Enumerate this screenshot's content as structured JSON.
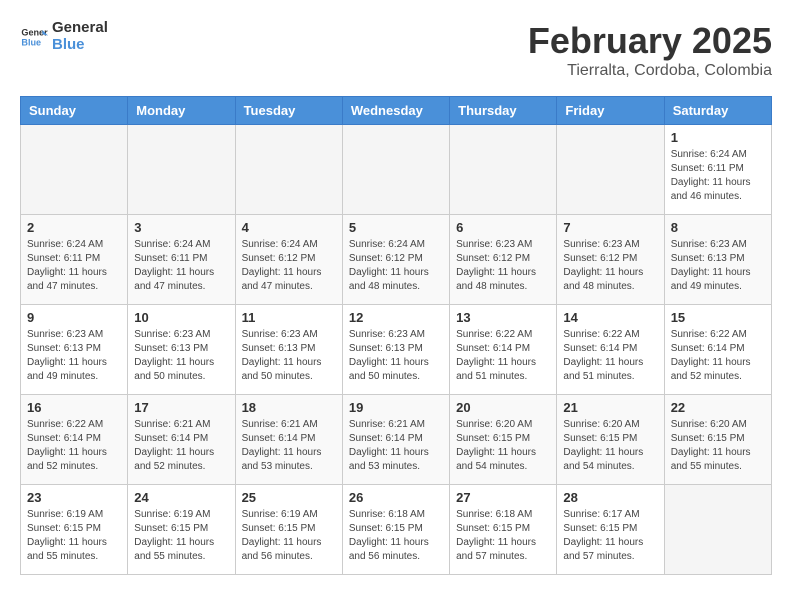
{
  "header": {
    "logo_general": "General",
    "logo_blue": "Blue",
    "month": "February 2025",
    "location": "Tierralta, Cordoba, Colombia"
  },
  "days_of_week": [
    "Sunday",
    "Monday",
    "Tuesday",
    "Wednesday",
    "Thursday",
    "Friday",
    "Saturday"
  ],
  "weeks": [
    [
      {
        "day": "",
        "info": ""
      },
      {
        "day": "",
        "info": ""
      },
      {
        "day": "",
        "info": ""
      },
      {
        "day": "",
        "info": ""
      },
      {
        "day": "",
        "info": ""
      },
      {
        "day": "",
        "info": ""
      },
      {
        "day": "1",
        "info": "Sunrise: 6:24 AM\nSunset: 6:11 PM\nDaylight: 11 hours and 46 minutes."
      }
    ],
    [
      {
        "day": "2",
        "info": "Sunrise: 6:24 AM\nSunset: 6:11 PM\nDaylight: 11 hours and 47 minutes."
      },
      {
        "day": "3",
        "info": "Sunrise: 6:24 AM\nSunset: 6:11 PM\nDaylight: 11 hours and 47 minutes."
      },
      {
        "day": "4",
        "info": "Sunrise: 6:24 AM\nSunset: 6:12 PM\nDaylight: 11 hours and 47 minutes."
      },
      {
        "day": "5",
        "info": "Sunrise: 6:24 AM\nSunset: 6:12 PM\nDaylight: 11 hours and 48 minutes."
      },
      {
        "day": "6",
        "info": "Sunrise: 6:23 AM\nSunset: 6:12 PM\nDaylight: 11 hours and 48 minutes."
      },
      {
        "day": "7",
        "info": "Sunrise: 6:23 AM\nSunset: 6:12 PM\nDaylight: 11 hours and 48 minutes."
      },
      {
        "day": "8",
        "info": "Sunrise: 6:23 AM\nSunset: 6:13 PM\nDaylight: 11 hours and 49 minutes."
      }
    ],
    [
      {
        "day": "9",
        "info": "Sunrise: 6:23 AM\nSunset: 6:13 PM\nDaylight: 11 hours and 49 minutes."
      },
      {
        "day": "10",
        "info": "Sunrise: 6:23 AM\nSunset: 6:13 PM\nDaylight: 11 hours and 50 minutes."
      },
      {
        "day": "11",
        "info": "Sunrise: 6:23 AM\nSunset: 6:13 PM\nDaylight: 11 hours and 50 minutes."
      },
      {
        "day": "12",
        "info": "Sunrise: 6:23 AM\nSunset: 6:13 PM\nDaylight: 11 hours and 50 minutes."
      },
      {
        "day": "13",
        "info": "Sunrise: 6:22 AM\nSunset: 6:14 PM\nDaylight: 11 hours and 51 minutes."
      },
      {
        "day": "14",
        "info": "Sunrise: 6:22 AM\nSunset: 6:14 PM\nDaylight: 11 hours and 51 minutes."
      },
      {
        "day": "15",
        "info": "Sunrise: 6:22 AM\nSunset: 6:14 PM\nDaylight: 11 hours and 52 minutes."
      }
    ],
    [
      {
        "day": "16",
        "info": "Sunrise: 6:22 AM\nSunset: 6:14 PM\nDaylight: 11 hours and 52 minutes."
      },
      {
        "day": "17",
        "info": "Sunrise: 6:21 AM\nSunset: 6:14 PM\nDaylight: 11 hours and 52 minutes."
      },
      {
        "day": "18",
        "info": "Sunrise: 6:21 AM\nSunset: 6:14 PM\nDaylight: 11 hours and 53 minutes."
      },
      {
        "day": "19",
        "info": "Sunrise: 6:21 AM\nSunset: 6:14 PM\nDaylight: 11 hours and 53 minutes."
      },
      {
        "day": "20",
        "info": "Sunrise: 6:20 AM\nSunset: 6:15 PM\nDaylight: 11 hours and 54 minutes."
      },
      {
        "day": "21",
        "info": "Sunrise: 6:20 AM\nSunset: 6:15 PM\nDaylight: 11 hours and 54 minutes."
      },
      {
        "day": "22",
        "info": "Sunrise: 6:20 AM\nSunset: 6:15 PM\nDaylight: 11 hours and 55 minutes."
      }
    ],
    [
      {
        "day": "23",
        "info": "Sunrise: 6:19 AM\nSunset: 6:15 PM\nDaylight: 11 hours and 55 minutes."
      },
      {
        "day": "24",
        "info": "Sunrise: 6:19 AM\nSunset: 6:15 PM\nDaylight: 11 hours and 55 minutes."
      },
      {
        "day": "25",
        "info": "Sunrise: 6:19 AM\nSunset: 6:15 PM\nDaylight: 11 hours and 56 minutes."
      },
      {
        "day": "26",
        "info": "Sunrise: 6:18 AM\nSunset: 6:15 PM\nDaylight: 11 hours and 56 minutes."
      },
      {
        "day": "27",
        "info": "Sunrise: 6:18 AM\nSunset: 6:15 PM\nDaylight: 11 hours and 57 minutes."
      },
      {
        "day": "28",
        "info": "Sunrise: 6:17 AM\nSunset: 6:15 PM\nDaylight: 11 hours and 57 minutes."
      },
      {
        "day": "",
        "info": ""
      }
    ]
  ]
}
